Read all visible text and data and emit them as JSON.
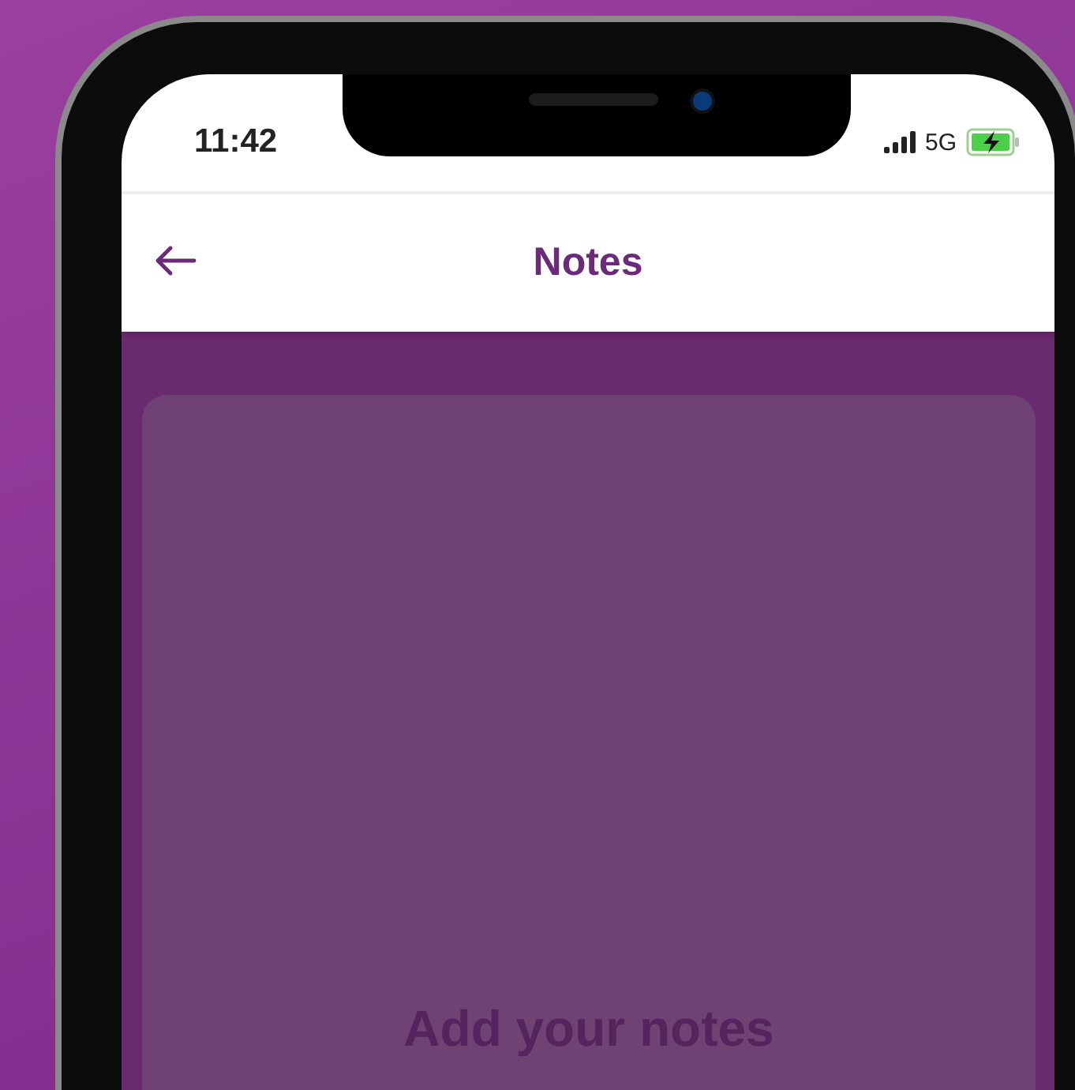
{
  "status_bar": {
    "time": "11:42",
    "network": "5G"
  },
  "header": {
    "title": "Notes"
  },
  "notes_card": {
    "message": "Add your notes"
  }
}
